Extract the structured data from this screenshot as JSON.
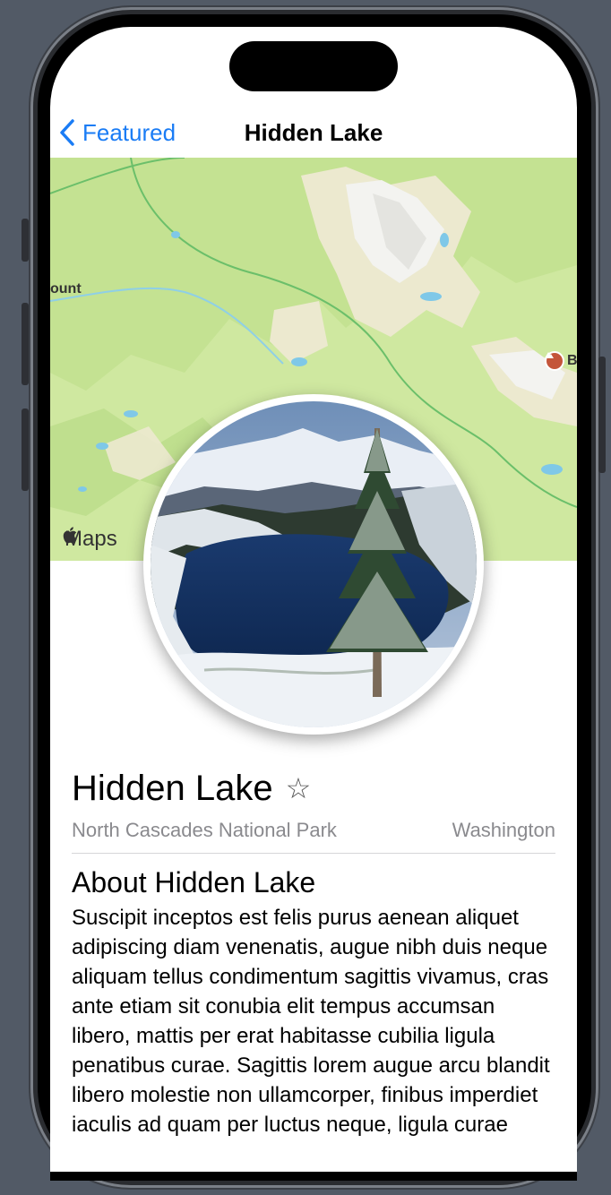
{
  "nav": {
    "back_label": "Featured",
    "title": "Hidden Lake"
  },
  "map": {
    "label_left": "ount",
    "poi_label": "Bu",
    "attribution": "Maps",
    "colors": {
      "land": "#cfe8a0",
      "snow": "#f2f2ef",
      "sand": "#ece9cf",
      "water": "#7fc8e8",
      "park_border": "#6bbf6a"
    }
  },
  "landmark": {
    "name": "Hidden Lake",
    "favorite_icon": "star-outline-icon",
    "park": "North Cascades National Park",
    "state": "Washington",
    "about_heading": "About Hidden Lake",
    "description": "Suscipit inceptos est felis purus aenean aliquet adipiscing diam venenatis, augue nibh duis neque aliquam tellus condimentum sagittis vivamus, cras ante etiam sit conubia elit tempus accumsan libero, mattis per erat habitasse cubilia ligula penatibus curae. Sagittis lorem augue arcu blandit libero molestie non ullamcorper, finibus imperdiet iaculis ad quam per luctus neque, ligula curae"
  },
  "accent_color": "#1a7cf5"
}
